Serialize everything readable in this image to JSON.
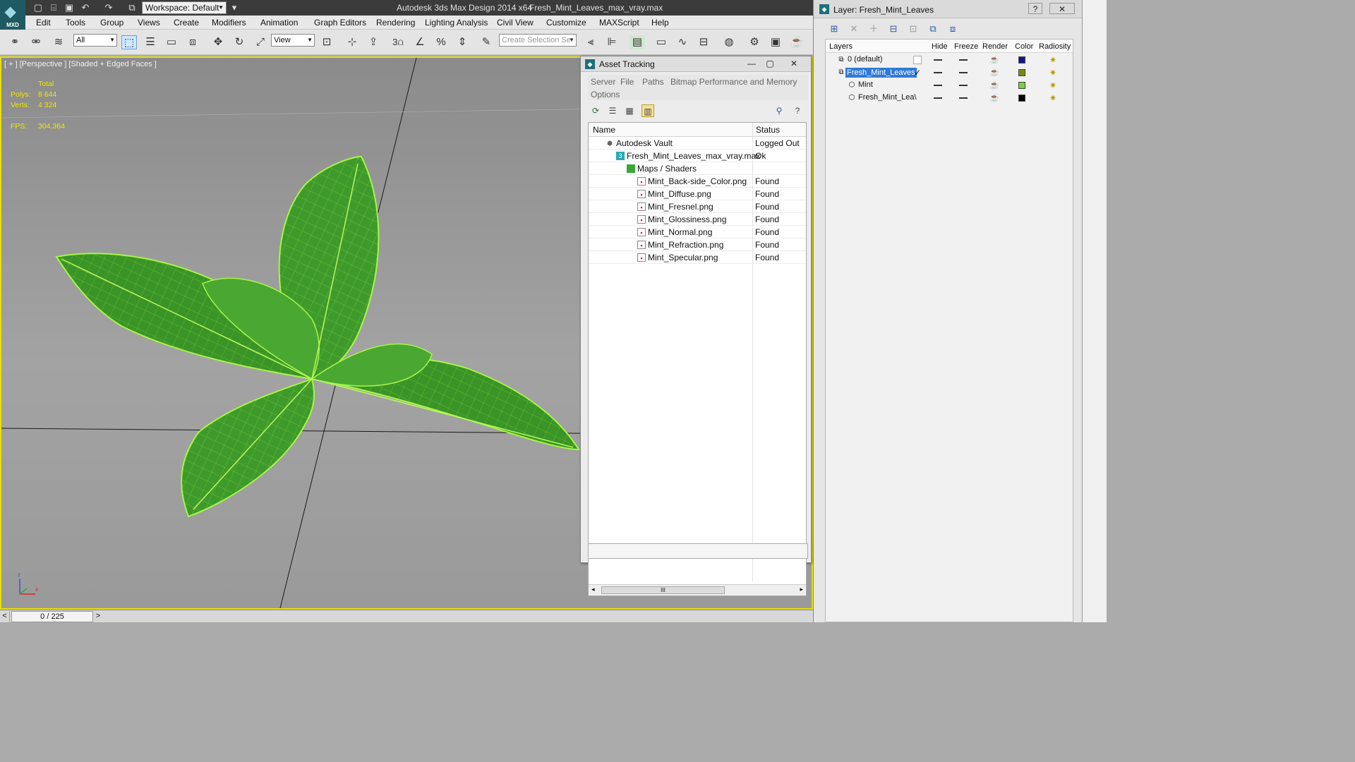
{
  "app": {
    "logo_text": "MXD",
    "workspace": "Workspace: Default",
    "title": "Autodesk 3ds Max Design 2014 x64",
    "file": "Fresh_Mint_Leaves_max_vray.max"
  },
  "menu": [
    "Edit",
    "Tools",
    "Group",
    "Views",
    "Create",
    "Modifiers",
    "Animation",
    "Graph Editors",
    "Rendering",
    "Lighting Analysis",
    "Civil View",
    "Customize",
    "MAXScript",
    "Help"
  ],
  "toolbar": {
    "filter": "All",
    "ref_coord": "View",
    "selection_set_placeholder": "Create Selection Se",
    "snap_label": "3"
  },
  "viewport": {
    "label": "[ + ] [Perspective ] [Shaded + Edged Faces ]",
    "stats": {
      "total_label": "Total",
      "polys_label": "Polys:",
      "polys": "8 644",
      "verts_label": "Verts:",
      "verts": "4 324",
      "fps_label": "FPS:",
      "fps": "304,364"
    },
    "axis_z": "z",
    "axis_x": "x"
  },
  "timeline": {
    "frame": "0 / 225",
    "prev": "<",
    "next": ">"
  },
  "asset_tracking": {
    "title": "Asset Tracking",
    "menu": [
      "Server",
      "File",
      "Paths",
      "Bitmap Performance and Memory",
      "Options"
    ],
    "columns": {
      "name": "Name",
      "status": "Status"
    },
    "rows": [
      {
        "name": "Autodesk Vault",
        "status": "Logged Out ..."
      },
      {
        "name": "Fresh_Mint_Leaves_max_vray.max",
        "status": "Ok"
      },
      {
        "name": "Maps / Shaders",
        "status": ""
      },
      {
        "name": "Mint_Back-side_Color.png",
        "status": "Found"
      },
      {
        "name": "Mint_Diffuse.png",
        "status": "Found"
      },
      {
        "name": "Mint_Fresnel.png",
        "status": "Found"
      },
      {
        "name": "Mint_Glossiness.png",
        "status": "Found"
      },
      {
        "name": "Mint_Normal.png",
        "status": "Found"
      },
      {
        "name": "Mint_Refraction.png",
        "status": "Found"
      },
      {
        "name": "Mint_Specular.png",
        "status": "Found"
      }
    ],
    "scroll_thumb": "III"
  },
  "layer_manager": {
    "title": "Layer: Fresh_Mint_Leaves",
    "columns": {
      "layers": "Layers",
      "hide": "Hide",
      "freeze": "Freeze",
      "render": "Render",
      "color": "Color",
      "radiosity": "Radiosity"
    },
    "rows": [
      {
        "name": "0 (default)",
        "color": "#0a1a8a"
      },
      {
        "name": "Fresh_Mint_Leaves",
        "color": "#7a8a10",
        "active_mark": "✓"
      },
      {
        "name": "Mint",
        "color": "#7ccf3a"
      },
      {
        "name": "Fresh_Mint_Lea\\",
        "color": "#000000"
      }
    ]
  },
  "colors": {
    "viewport_border": "#e8e000",
    "leaf_wire": "#9cf03a",
    "selection": "#2f7ad8"
  }
}
